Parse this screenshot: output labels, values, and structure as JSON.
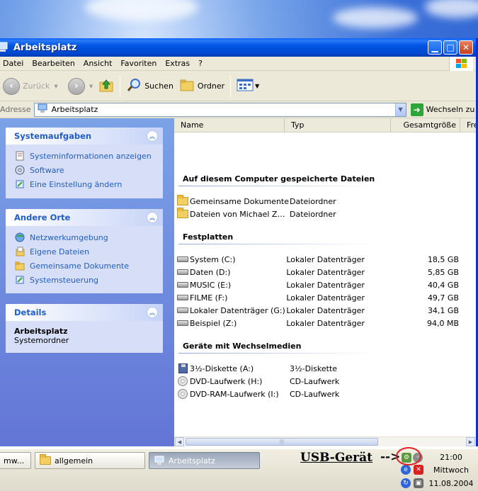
{
  "window": {
    "title": "Arbeitsplatz",
    "menu": [
      "Datei",
      "Bearbeiten",
      "Ansicht",
      "Favoriten",
      "Extras",
      "?"
    ]
  },
  "toolbar": {
    "back_label": "Zurück",
    "search_label": "Suchen",
    "folders_label": "Ordner"
  },
  "address": {
    "label": "Adresse",
    "value": "Arbeitsplatz",
    "go_label": "Wechseln zu"
  },
  "sidebar": {
    "system_tasks": {
      "title": "Systemaufgaben",
      "items": [
        "Systeminformationen anzeigen",
        "Software",
        "Eine Einstellung ändern"
      ]
    },
    "other_places": {
      "title": "Andere Orte",
      "items": [
        "Netzwerkumgebung",
        "Eigene Dateien",
        "Gemeinsame Dokumente",
        "Systemsteuerung"
      ]
    },
    "details": {
      "title": "Details",
      "name": "Arbeitsplatz",
      "subtitle": "Systemordner"
    }
  },
  "columns": [
    "Name",
    "Typ",
    "Gesamtgröße",
    "Fre"
  ],
  "sections": {
    "stored_files": {
      "title": "Auf diesem Computer gespeicherte Dateien",
      "rows": [
        {
          "name": "Gemeinsame Dokumente",
          "type": "Dateiordner",
          "size": ""
        },
        {
          "name": "Dateien von Michael Zw...",
          "type": "Dateiordner",
          "size": ""
        }
      ]
    },
    "hard_disks": {
      "title": "Festplatten",
      "rows": [
        {
          "name": "System (C:)",
          "type": "Lokaler Datenträger",
          "size": "18,5 GB"
        },
        {
          "name": "Daten (D:)",
          "type": "Lokaler Datenträger",
          "size": "5,85 GB"
        },
        {
          "name": "MUSIC (E:)",
          "type": "Lokaler Datenträger",
          "size": "40,4 GB"
        },
        {
          "name": "FILME (F:)",
          "type": "Lokaler Datenträger",
          "size": "49,7 GB"
        },
        {
          "name": "Lokaler Datenträger (G:)",
          "type": "Lokaler Datenträger",
          "size": "34,1 GB"
        },
        {
          "name": "Beispiel (Z:)",
          "type": "Lokaler Datenträger",
          "size": "94,0 MB"
        }
      ]
    },
    "removable": {
      "title": "Geräte mit Wechselmedien",
      "rows": [
        {
          "name": "3½-Diskette (A:)",
          "type": "3½-Diskette",
          "size": ""
        },
        {
          "name": "DVD-Laufwerk (H:)",
          "type": "CD-Laufwerk",
          "size": ""
        },
        {
          "name": "DVD-RAM-Laufwerk (I:)",
          "type": "CD-Laufwerk",
          "size": ""
        }
      ]
    }
  },
  "taskbar": {
    "buttons": [
      "mw...",
      "allgemein",
      "Arbeitsplatz"
    ],
    "annotation": "USB-Gerät",
    "annotation_arrow": "-->",
    "clock_time": "21:00",
    "clock_day": "Mittwoch",
    "clock_date": "11.08.2004"
  }
}
